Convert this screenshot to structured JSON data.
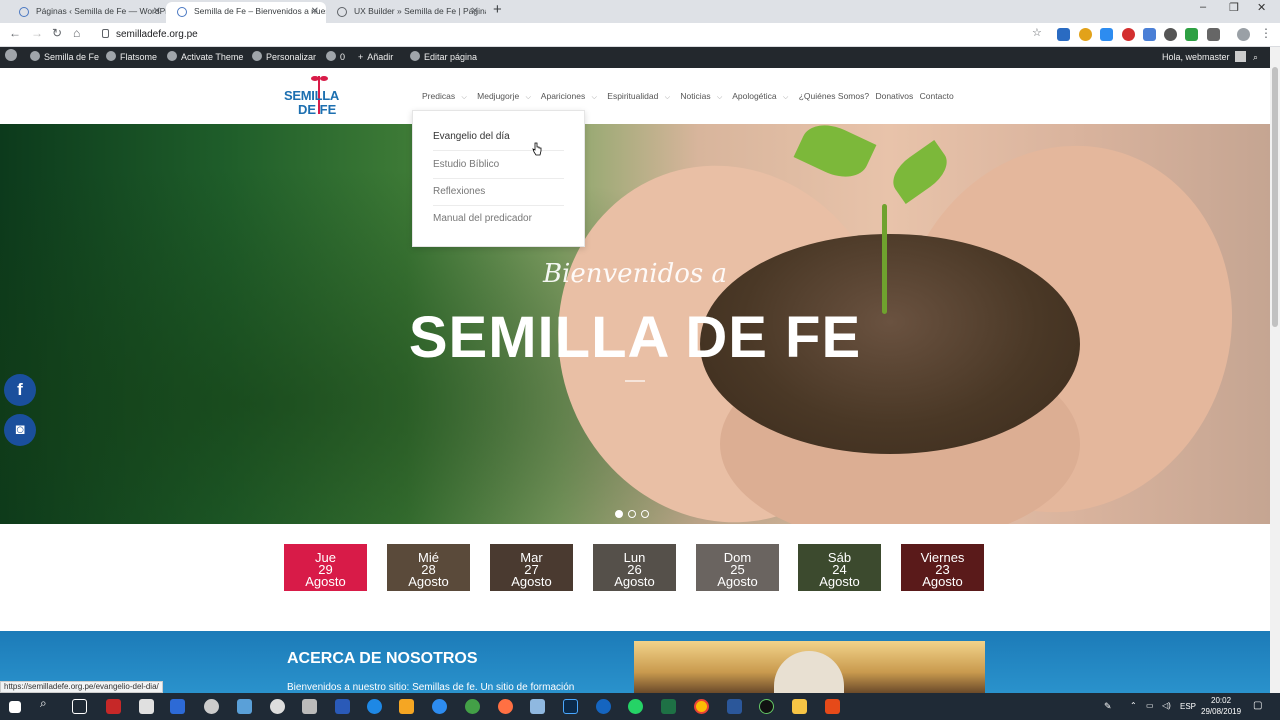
{
  "browser": {
    "tabs": [
      {
        "title": "Páginas ‹ Semilla de Fe — WordPress",
        "active": false
      },
      {
        "title": "Semilla de Fe – Bienvenidos a nuestro sitio",
        "active": true
      },
      {
        "title": "UX Builder » Semilla de Fe | Página",
        "active": false
      }
    ],
    "new_tab": "+",
    "url": "semilladefe.org.pe",
    "window_controls": {
      "minimize": "–",
      "maximize": "❐",
      "close": "✕"
    }
  },
  "wpbar": {
    "site": "Semilla de Fe",
    "theme": "Flatsome",
    "activate": "Activate Theme",
    "customize": "Personalizar",
    "comments": "0",
    "add": "Añadir",
    "edit": "Editar página",
    "greeting": "Hola, webmaster"
  },
  "site": {
    "logo_top": "SEMILLA",
    "logo_bottom": "DE FE",
    "menu": [
      {
        "label": "Predicas",
        "dropdown": true
      },
      {
        "label": "Medjugorje",
        "dropdown": true
      },
      {
        "label": "Apariciones",
        "dropdown": true
      },
      {
        "label": "Espiritualidad",
        "dropdown": true
      },
      {
        "label": "Noticias",
        "dropdown": true
      },
      {
        "label": "Apologética",
        "dropdown": true
      },
      {
        "label": "¿Quiénes Somos?",
        "dropdown": false
      },
      {
        "label": "Donativos",
        "dropdown": false
      },
      {
        "label": "Contacto",
        "dropdown": false
      }
    ],
    "dropdown_items": [
      "Evangelio del día",
      "Estudio Bíblico",
      "Reflexiones",
      "Manual del predicador"
    ]
  },
  "hero": {
    "subtitle": "Bienvenidos a",
    "title": "SEMILLA DE FE",
    "slides": 3,
    "active_slide": 1
  },
  "dates": [
    {
      "day": "Jue",
      "num": "29",
      "month": "Agosto",
      "color": "#d81b48"
    },
    {
      "day": "Mié",
      "num": "28",
      "month": "Agosto",
      "color": "#5a4a3a"
    },
    {
      "day": "Mar",
      "num": "27",
      "month": "Agosto",
      "color": "#4a3a30"
    },
    {
      "day": "Lun",
      "num": "26",
      "month": "Agosto",
      "color": "#55504a"
    },
    {
      "day": "Dom",
      "num": "25",
      "month": "Agosto",
      "color": "#6a6460"
    },
    {
      "day": "Sáb",
      "num": "24",
      "month": "Agosto",
      "color": "#3c4a2e"
    },
    {
      "day": "Viernes",
      "num": "23",
      "month": "Agosto",
      "color": "#5a1a1a"
    }
  ],
  "about": {
    "title": "ACERCA DE NOSOTROS",
    "text": "Bienvenidos a nuestro sitio: Semillas de fe. Un sitio de formación"
  },
  "status_url": "https://semilladefe.org.pe/evangelio-del-dia/",
  "taskbar": {
    "lang": "ESP",
    "time": "20:02",
    "date": "29/08/2019"
  }
}
